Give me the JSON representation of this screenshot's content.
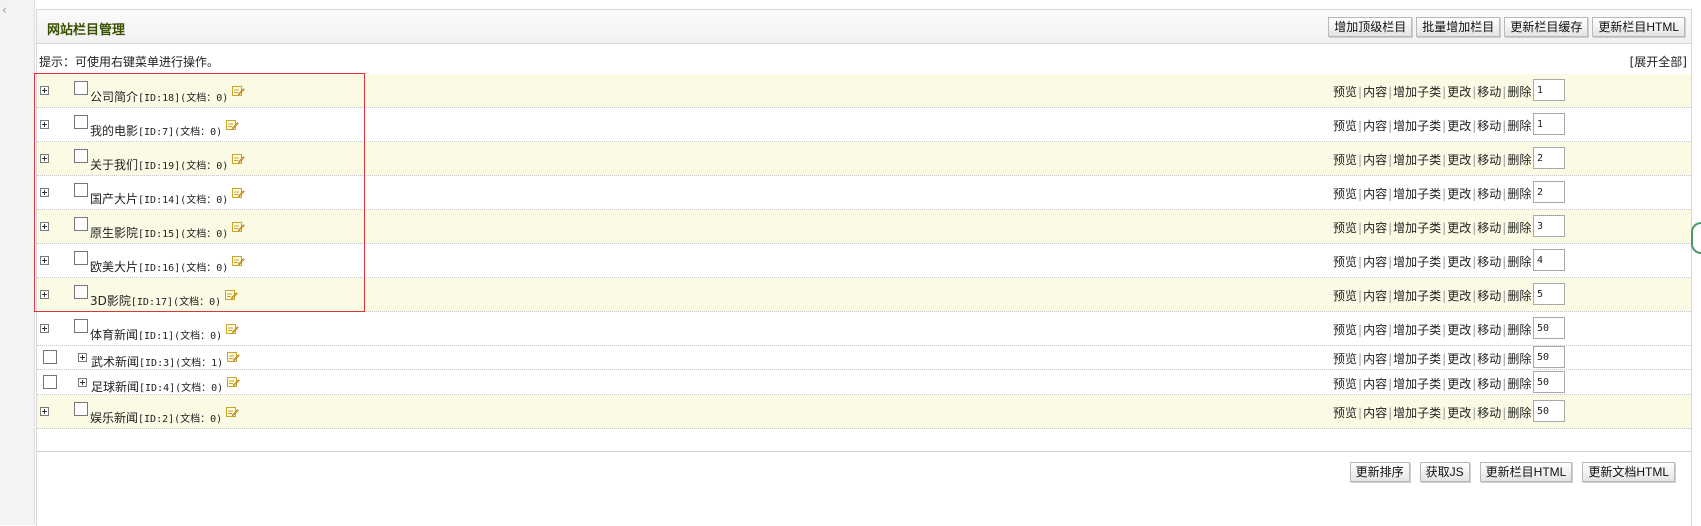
{
  "page": {
    "title": "网站栏目管理",
    "top_buttons": [
      "增加顶级栏目",
      "批量增加栏目",
      "更新栏目缓存",
      "更新栏目HTML"
    ],
    "tip": "提示：可使用右键菜单进行操作。",
    "expand_all": "[展开全部]",
    "bottom_buttons": [
      "更新排序",
      "获取JS",
      "更新栏目HTML",
      "更新文档HTML"
    ]
  },
  "actions": [
    "预览",
    "内容",
    "增加子类",
    "更改",
    "移动",
    "删除"
  ],
  "categories": [
    {
      "name": "公司简介",
      "id": "[ID:18]",
      "docs": "(文档：0)",
      "order": "1"
    },
    {
      "name": "我的电影",
      "id": "[ID:7]",
      "docs": "(文档：0)",
      "order": "1"
    },
    {
      "name": "关于我们",
      "id": "[ID:19]",
      "docs": "(文档：0)",
      "order": "2"
    },
    {
      "name": "国产大片",
      "id": "[ID:14]",
      "docs": "(文档：0)",
      "order": "2"
    },
    {
      "name": "原生影院",
      "id": "[ID:15]",
      "docs": "(文档：0)",
      "order": "3"
    },
    {
      "name": "欧美大片",
      "id": "[ID:16]",
      "docs": "(文档：0)",
      "order": "4"
    },
    {
      "name": "3D影院",
      "id": "[ID:17]",
      "docs": "(文档：0)",
      "order": "5"
    },
    {
      "name": "体育新闻",
      "id": "[ID:1]",
      "docs": "(文档：0)",
      "order": "50"
    },
    {
      "name": "武术新闻",
      "id": "[ID:3]",
      "docs": "(文档：1)",
      "order": "50"
    },
    {
      "name": "足球新闻",
      "id": "[ID:4]",
      "docs": "(文档：0)",
      "order": "50"
    },
    {
      "name": "娱乐新闻",
      "id": "[ID:2]",
      "docs": "(文档：0)",
      "order": "50"
    }
  ],
  "colors": {
    "row_alt_bg": "#fbfbe5",
    "title_color": "#3a5200",
    "highlight_border": "#e0343c",
    "edit_icon": "#e0a020"
  }
}
